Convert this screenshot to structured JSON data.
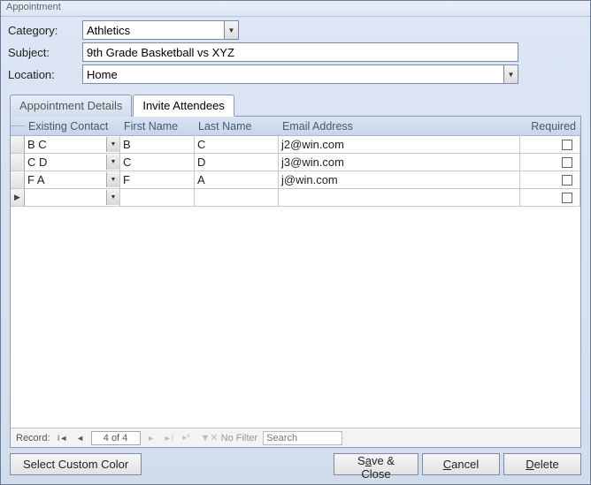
{
  "window": {
    "title": "Appointment"
  },
  "form": {
    "category_label": "Category:",
    "category_value": "Athletics",
    "subject_label": "Subject:",
    "subject_value": "9th Grade Basketball vs XYZ",
    "location_label": "Location:",
    "location_value": "Home"
  },
  "tabs": {
    "details": "Appointment Details",
    "invite": "Invite Attendees"
  },
  "grid": {
    "headers": {
      "contact": "Existing Contact",
      "first": "First Name",
      "last": "Last Name",
      "email": "Email Address",
      "required": "Required"
    },
    "rows": [
      {
        "contact": "B C",
        "first": "B",
        "last": "C",
        "email": "j2@win.com",
        "required": false
      },
      {
        "contact": "C D",
        "first": "C",
        "last": "D",
        "email": "j3@win.com",
        "required": false
      },
      {
        "contact": "F A",
        "first": "F",
        "last": "A",
        "email": "j@win.com",
        "required": false
      }
    ]
  },
  "recnav": {
    "label": "Record:",
    "position": "4 of 4",
    "nofilter": "No Filter",
    "search_placeholder": "Search"
  },
  "buttons": {
    "custom_color": "Select Custom Color",
    "save_close_pre": "S",
    "save_close_u": "a",
    "save_close_post": "ve & Close",
    "cancel_pre": "",
    "cancel_u": "C",
    "cancel_post": "ancel",
    "delete_pre": "",
    "delete_u": "D",
    "delete_post": "elete"
  }
}
